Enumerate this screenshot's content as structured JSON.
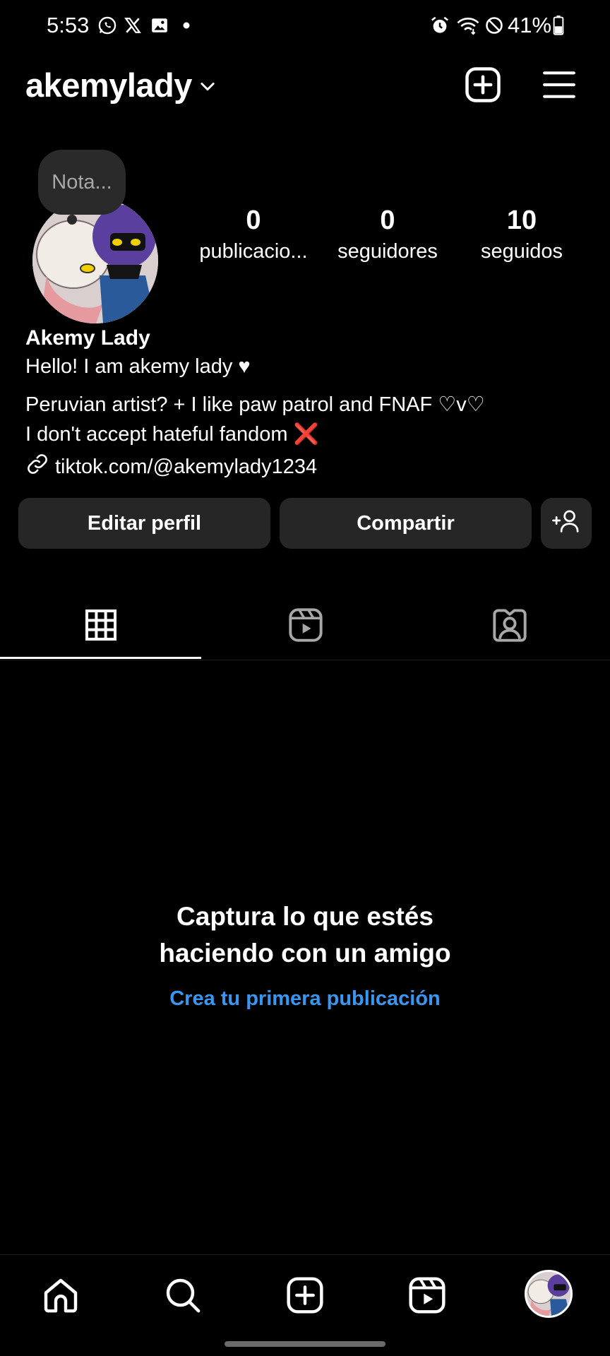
{
  "status_bar": {
    "time": "5:53",
    "battery": "41%",
    "icons_left": [
      "whatsapp-icon",
      "x-icon",
      "gallery-icon",
      "dot-icon"
    ],
    "icons_right": [
      "alarm-icon",
      "wifi-icon",
      "do-not-disturb-icon",
      "battery-icon"
    ]
  },
  "header": {
    "username": "akemylady",
    "icons": [
      "chevron-down-icon",
      "create-icon",
      "menu-icon"
    ]
  },
  "profile": {
    "note": "Nota...",
    "stats": [
      {
        "value": "0",
        "label": "publicacio..."
      },
      {
        "value": "0",
        "label": "seguidores"
      },
      {
        "value": "10",
        "label": "seguidos"
      }
    ],
    "display_name": "Akemy Lady",
    "bio": [
      "Hello! I am akemy lady ♥",
      "Peruvian artist? + I like paw patrol and FNAF ♡v♡",
      "I don't accept hateful fandom ❌"
    ],
    "link": "tiktok.com/@akemylady1234"
  },
  "actions": {
    "edit": "Editar perfil",
    "share": "Compartir",
    "add_person_icon": "add-person-icon"
  },
  "tabs": {
    "items": [
      "grid-icon",
      "reels-icon",
      "tagged-icon"
    ],
    "active_index": 0
  },
  "empty_state": {
    "title_line1": "Captura lo que estés",
    "title_line2": "haciendo con un amigo",
    "link": "Crea tu primera publicación"
  },
  "bottom_nav": {
    "items": [
      "home-icon",
      "search-icon",
      "create-icon",
      "reels-icon",
      "profile-avatar"
    ]
  },
  "colors": {
    "background": "#000000",
    "button": "#262626",
    "link_blue": "#3897f0",
    "bubble": "#2a2a2a",
    "note_text": "#a8a8a8"
  }
}
